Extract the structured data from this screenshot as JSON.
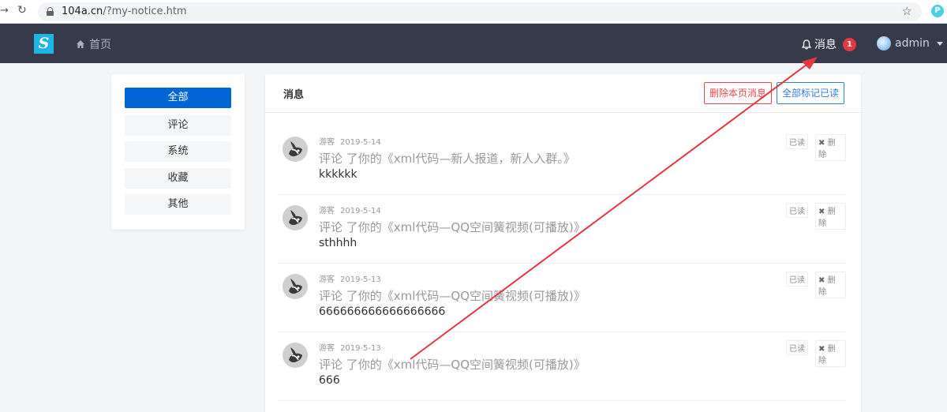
{
  "browser": {
    "url_host": "104a.cn",
    "url_path": "/?my-notice.htm",
    "profile_initial": "P"
  },
  "navbar": {
    "logo": "S",
    "home": "首页",
    "messages_label": "消息",
    "messages_count": "1",
    "username": "admin"
  },
  "sidebar": {
    "items": [
      {
        "label": "全部",
        "active": true
      },
      {
        "label": "评论"
      },
      {
        "label": "系统"
      },
      {
        "label": "收藏"
      },
      {
        "label": "其他"
      }
    ]
  },
  "panel": {
    "title": "消息",
    "delete_page_button": "删除本页消息",
    "mark_all_read_button": "全部标记已读"
  },
  "notices": [
    {
      "user": "游客",
      "date": "2019-5-14",
      "text": "评论 了你的《xml代码—新人报道，新人入群。》",
      "content": "kkkkkk",
      "read": "已读",
      "delete": "删除"
    },
    {
      "user": "游客",
      "date": "2019-5-14",
      "text": "评论 了你的《xml代码—QQ空间簧视频(可播放)》",
      "content": "sthhhh",
      "read": "已读",
      "delete": "删除"
    },
    {
      "user": "游客",
      "date": "2019-5-13",
      "text": "评论 了你的《xml代码—QQ空间簧视频(可播放)》",
      "content": "666666666666666666",
      "read": "已读",
      "delete": "删除"
    },
    {
      "user": "游客",
      "date": "2019-5-13",
      "text": "评论 了你的《xml代码—QQ空间簧视频(可播放)》",
      "content": "666",
      "read": "已读",
      "delete": "删除"
    }
  ],
  "annotation": {
    "color": "#e8363e"
  }
}
